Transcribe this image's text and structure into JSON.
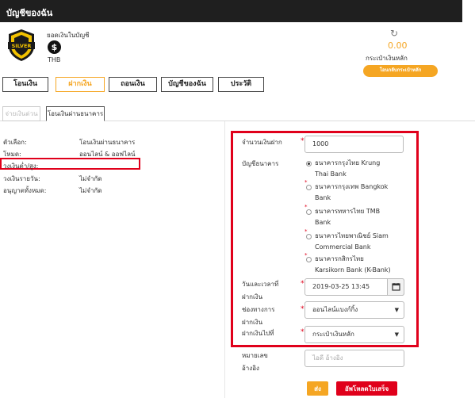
{
  "header": {
    "title": "บัญชีของฉัน"
  },
  "account": {
    "badge_text": "SILVER",
    "balance_label": "ยอดเงินในบัญชี",
    "currency": "THB",
    "amount": "0.00",
    "wallet_label": "กระเป๋าเงินหลัก",
    "wallet_button": "โอนกลับกระเป๋าหลัก"
  },
  "tabs": [
    {
      "label": "โอนเงิน"
    },
    {
      "label": "ฝากเงิน"
    },
    {
      "label": "ถอนเงิน"
    },
    {
      "label": "บัญชีของฉัน"
    },
    {
      "label": "ประวัติ"
    }
  ],
  "subtabs": [
    {
      "label": "จ่ายเงินด่วน"
    },
    {
      "label": "โอนเงินผ่านธนาคาร"
    }
  ],
  "info": [
    {
      "label": "ตัวเลือก:",
      "value": "โอนเงินผ่านธนาคาร"
    },
    {
      "label": "โหมด:",
      "value": "ออนไลน์ & ออฟไลน์"
    },
    {
      "label": "วงเงินต่ำ/สูง:",
      "value": ""
    },
    {
      "label": "วงเงินรายวัน:",
      "value": "ไม่จำกัด"
    },
    {
      "label": "อนุญาตทั้งหมด:",
      "value": "ไม่จำกัด"
    }
  ],
  "form": {
    "amount_label": "จำนวนเงินฝาก",
    "amount_value": "1000",
    "bank_label": "บัญชีธนาคาร",
    "banks": [
      {
        "line1": "ธนาคารกรุงไทย Krung",
        "line2": "Thai Bank"
      },
      {
        "line1": "ธนาคารกรุงเทพ Bangkok",
        "line2": "Bank"
      },
      {
        "line1": "ธนาคารทหารไทย TMB",
        "line2": "Bank"
      },
      {
        "line1": "ธนาคารไทยพาณิชย์ Siam",
        "line2": "Commercial Bank"
      },
      {
        "line1": "ธนาคารกสิกรไทย",
        "line2": "Karsikorn Bank (K-Bank)"
      }
    ],
    "datetime_label_1": "วันและเวลาที่",
    "datetime_label_2": "ฝากเงิน",
    "datetime_value": "2019-03-25 13:45",
    "channel_label_1": "ช่องทางการ",
    "channel_label_2": "ฝากเงิน",
    "channel_value": "ออนไลน์แบงก์กิ้ง",
    "deposit_to_label": "ฝากเงินไปที่",
    "deposit_to_value": "กระเป๋าเงินหลัก",
    "ref_label_1": "หมายเลข",
    "ref_label_2": "อ้างอิง",
    "ref_placeholder": "ไอดี อ้างอิง",
    "required_mark": "*"
  },
  "actions": {
    "send": "ส่ง",
    "upload": "อัพโหลดใบเสร็จ"
  },
  "colors": {
    "accent": "#f5a623",
    "highlight": "#e0001b",
    "header_bg": "#1f1f1f"
  }
}
